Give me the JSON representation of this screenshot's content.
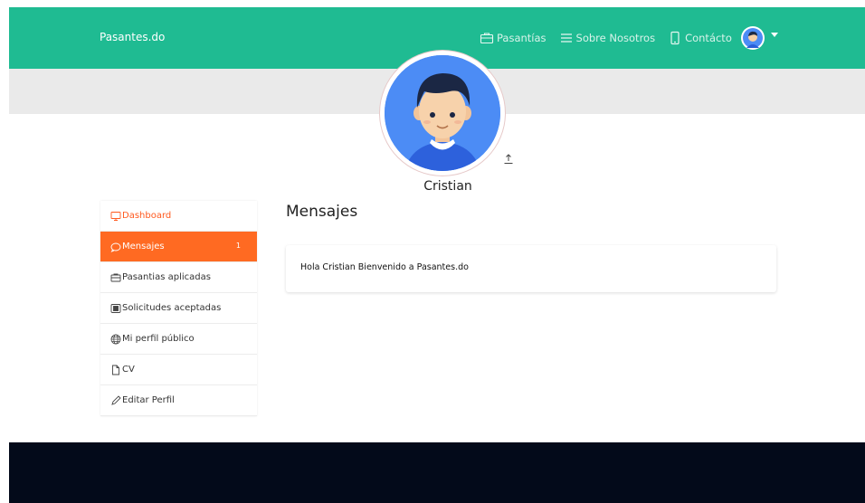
{
  "navbar": {
    "brand": "Pasantes.do",
    "links": [
      {
        "label": "Pasantías",
        "icon": "briefcase-icon"
      },
      {
        "label": "Sobre Nosotros",
        "icon": "menu-lines-icon"
      },
      {
        "label": "Contácto",
        "icon": "phone-icon"
      }
    ]
  },
  "profile": {
    "name": "Cristian"
  },
  "sidebar": {
    "items": [
      {
        "label": "Dashboard",
        "icon": "monitor-icon"
      },
      {
        "label": "Mensajes",
        "icon": "chat-bubble-icon",
        "badge": "1"
      },
      {
        "label": "Pasantias aplicadas",
        "icon": "briefcase-icon"
      },
      {
        "label": "Solicitudes aceptadas",
        "icon": "tray-icon"
      },
      {
        "label": "Mi perfil público",
        "icon": "globe-icon"
      },
      {
        "label": "CV",
        "icon": "document-icon"
      },
      {
        "label": "Editar Perfil",
        "icon": "pencil-icon"
      }
    ]
  },
  "main": {
    "title": "Mensajes",
    "messages": [
      {
        "text": "Hola Cristian Bienvenido a Pasantes.do"
      }
    ]
  },
  "colors": {
    "navbar": "#1fbb92",
    "accent": "#ff6a22",
    "footer": "#030a1a"
  }
}
